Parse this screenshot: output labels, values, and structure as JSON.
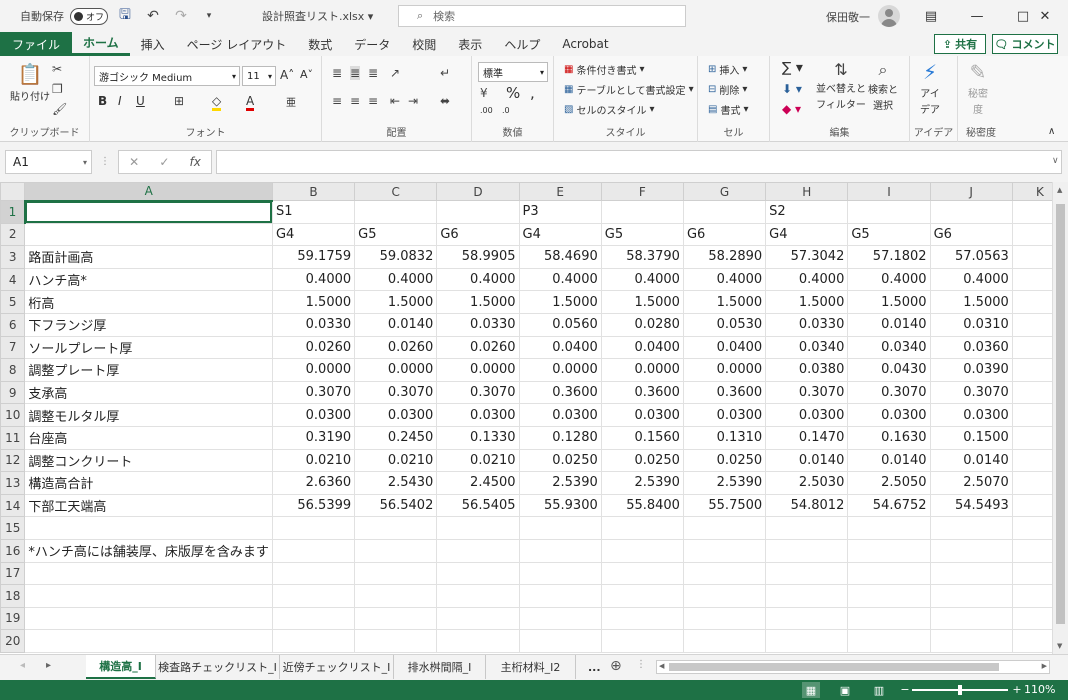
{
  "titlebar": {
    "autosave_label": "自動保存",
    "autosave_state": "オフ",
    "document_title": "設計照査リスト.xlsx",
    "search_placeholder": "検索",
    "user_name": "保田敬一"
  },
  "ribbon_tabs": [
    "ファイル",
    "ホーム",
    "挿入",
    "ページ レイアウト",
    "数式",
    "データ",
    "校閲",
    "表示",
    "ヘルプ",
    "Acrobat"
  ],
  "share_label": "共有",
  "comment_label": "コメント",
  "ribbon": {
    "clipboard": {
      "label": "クリップボード",
      "paste": "貼り付け"
    },
    "font": {
      "label": "フォント",
      "font_name": "游ゴシック Medium",
      "font_size": "11"
    },
    "alignment": {
      "label": "配置"
    },
    "number": {
      "label": "数値",
      "format": "標準"
    },
    "styles": {
      "label": "スタイル",
      "conditional": "条件付き書式",
      "table": "テーブルとして書式設定",
      "cell_styles": "セルのスタイル"
    },
    "cells": {
      "label": "セル",
      "insert": "挿入",
      "delete": "削除",
      "format": "書式"
    },
    "editing": {
      "label": "編集",
      "sort_1": "並べ替えと",
      "sort_2": "フィルター",
      "find_1": "検索と",
      "find_2": "選択"
    },
    "ideas": {
      "label": "アイデア",
      "btn_1": "アイ",
      "btn_2": "デア"
    },
    "sensitivity": {
      "label": "秘密度",
      "btn_1": "秘密",
      "btn_2": "度"
    }
  },
  "formula_bar": {
    "name_box": "A1",
    "formula": ""
  },
  "columns": [
    "A",
    "B",
    "C",
    "D",
    "E",
    "F",
    "G",
    "H",
    "I",
    "J",
    "K"
  ],
  "rows": [
    [
      "",
      "S1",
      "",
      "",
      "P3",
      "",
      "",
      "S2",
      "",
      "",
      ""
    ],
    [
      "",
      "G4",
      "G5",
      "G6",
      "G4",
      "G5",
      "G6",
      "G4",
      "G5",
      "G6",
      ""
    ],
    [
      "路面計画高",
      "59.1759",
      "59.0832",
      "58.9905",
      "58.4690",
      "58.3790",
      "58.2890",
      "57.3042",
      "57.1802",
      "57.0563",
      ""
    ],
    [
      "ハンチ高*",
      "0.4000",
      "0.4000",
      "0.4000",
      "0.4000",
      "0.4000",
      "0.4000",
      "0.4000",
      "0.4000",
      "0.4000",
      ""
    ],
    [
      "桁高",
      "1.5000",
      "1.5000",
      "1.5000",
      "1.5000",
      "1.5000",
      "1.5000",
      "1.5000",
      "1.5000",
      "1.5000",
      ""
    ],
    [
      "下フランジ厚",
      "0.0330",
      "0.0140",
      "0.0330",
      "0.0560",
      "0.0280",
      "0.0530",
      "0.0330",
      "0.0140",
      "0.0310",
      ""
    ],
    [
      "ソールプレート厚",
      "0.0260",
      "0.0260",
      "0.0260",
      "0.0400",
      "0.0400",
      "0.0400",
      "0.0340",
      "0.0340",
      "0.0360",
      ""
    ],
    [
      "調整プレート厚",
      "0.0000",
      "0.0000",
      "0.0000",
      "0.0000",
      "0.0000",
      "0.0000",
      "0.0380",
      "0.0430",
      "0.0390",
      ""
    ],
    [
      "支承高",
      "0.3070",
      "0.3070",
      "0.3070",
      "0.3600",
      "0.3600",
      "0.3600",
      "0.3070",
      "0.3070",
      "0.3070",
      ""
    ],
    [
      "調整モルタル厚",
      "0.0300",
      "0.0300",
      "0.0300",
      "0.0300",
      "0.0300",
      "0.0300",
      "0.0300",
      "0.0300",
      "0.0300",
      ""
    ],
    [
      "台座高",
      "0.3190",
      "0.2450",
      "0.1330",
      "0.1280",
      "0.1560",
      "0.1310",
      "0.1470",
      "0.1630",
      "0.1500",
      ""
    ],
    [
      "調整コンクリート",
      "0.0210",
      "0.0210",
      "0.0210",
      "0.0250",
      "0.0250",
      "0.0250",
      "0.0140",
      "0.0140",
      "0.0140",
      ""
    ],
    [
      "構造高合計",
      "2.6360",
      "2.5430",
      "2.4500",
      "2.5390",
      "2.5390",
      "2.5390",
      "2.5030",
      "2.5050",
      "2.5070",
      ""
    ],
    [
      "下部工天端高",
      "56.5399",
      "56.5402",
      "56.5405",
      "55.9300",
      "55.8400",
      "55.7500",
      "54.8012",
      "54.6752",
      "54.5493",
      ""
    ],
    [
      "",
      "",
      "",
      "",
      "",
      "",
      "",
      "",
      "",
      "",
      ""
    ],
    [
      "*ハンチ高には舗装厚、床版厚を含みます",
      "",
      "",
      "",
      "",
      "",
      "",
      "",
      "",
      "",
      ""
    ],
    [
      "",
      "",
      "",
      "",
      "",
      "",
      "",
      "",
      "",
      "",
      ""
    ],
    [
      "",
      "",
      "",
      "",
      "",
      "",
      "",
      "",
      "",
      "",
      ""
    ],
    [
      "",
      "",
      "",
      "",
      "",
      "",
      "",
      "",
      "",
      "",
      ""
    ],
    [
      "",
      "",
      "",
      "",
      "",
      "",
      "",
      "",
      "",
      "",
      ""
    ]
  ],
  "sheet_tabs": [
    "構造高_I",
    "検査路チェックリスト_I",
    "近傍チェックリスト_I",
    "排水桝間隔_I",
    "主桁材料_I2"
  ],
  "more_tabs": "...",
  "status": {
    "zoom": "110%"
  },
  "colors": {
    "accent": "#1e7145"
  }
}
